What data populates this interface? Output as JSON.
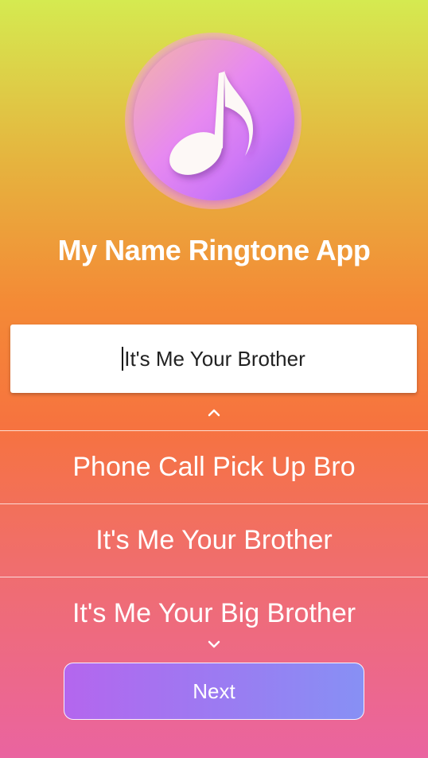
{
  "app": {
    "title": "My Name Ringtone App",
    "logo_icon": "music-note-icon"
  },
  "name_input": {
    "value": "It's Me Your Brother"
  },
  "picker": {
    "scroll_up_icon": "chevron-up-icon",
    "scroll_down_icon": "chevron-down-icon",
    "options": [
      {
        "label": "Phone Call Pick Up Bro"
      },
      {
        "label": "It's Me Your Brother"
      },
      {
        "label": "It's Me Your Big Brother"
      }
    ]
  },
  "actions": {
    "next_label": "Next"
  },
  "colors": {
    "gradient_top": "#d5ea50",
    "gradient_middle": "#f6733f",
    "gradient_bottom": "#ea64a0",
    "button_start": "#b466ee",
    "button_end": "#8790f4"
  }
}
